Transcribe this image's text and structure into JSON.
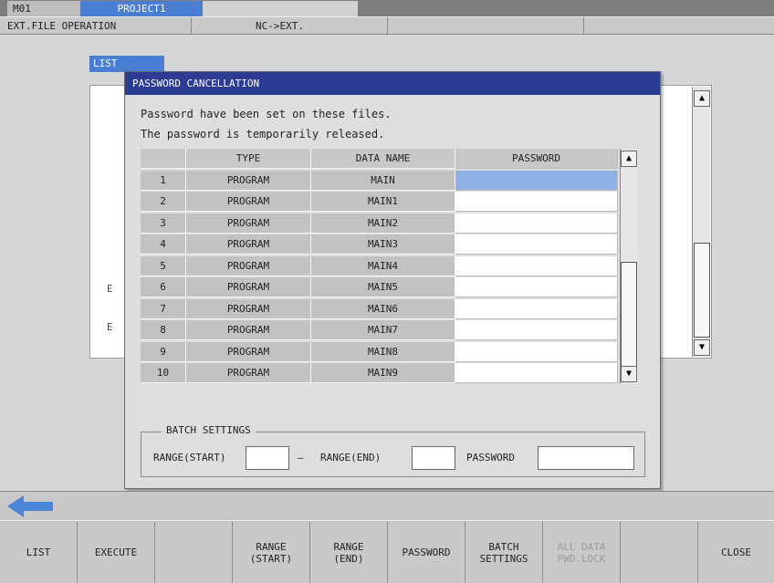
{
  "header": {
    "machine_tab": "M01",
    "project_tab": "PROJECT1",
    "sub_left": "EXT.FILE OPERATION",
    "sub_mid": "NC->EXT."
  },
  "background": {
    "list_tab": "LIST",
    "ghost_chars": [
      "E",
      "E"
    ]
  },
  "dialog": {
    "title": "PASSWORD CANCELLATION",
    "message_1": "Password have been set on these files.",
    "message_2": "The password is temporarily released.",
    "columns": [
      "",
      "TYPE",
      "DATA NAME",
      "PASSWORD"
    ],
    "rows": [
      {
        "no": "1",
        "type": "PROGRAM",
        "name": "MAIN",
        "password": ""
      },
      {
        "no": "2",
        "type": "PROGRAM",
        "name": "MAIN1",
        "password": ""
      },
      {
        "no": "3",
        "type": "PROGRAM",
        "name": "MAIN2",
        "password": ""
      },
      {
        "no": "4",
        "type": "PROGRAM",
        "name": "MAIN3",
        "password": ""
      },
      {
        "no": "5",
        "type": "PROGRAM",
        "name": "MAIN4",
        "password": ""
      },
      {
        "no": "6",
        "type": "PROGRAM",
        "name": "MAIN5",
        "password": ""
      },
      {
        "no": "7",
        "type": "PROGRAM",
        "name": "MAIN6",
        "password": ""
      },
      {
        "no": "8",
        "type": "PROGRAM",
        "name": "MAIN7",
        "password": ""
      },
      {
        "no": "9",
        "type": "PROGRAM",
        "name": "MAIN8",
        "password": ""
      },
      {
        "no": "10",
        "type": "PROGRAM",
        "name": "MAIN9",
        "password": ""
      }
    ],
    "selected_row": 1,
    "batch": {
      "legend": "BATCH SETTINGS",
      "range_start_label": "RANGE(START)",
      "dash": "–",
      "range_end_label": "RANGE(END)",
      "password_label": "PASSWORD",
      "range_start_value": "",
      "range_end_value": "",
      "password_value": ""
    }
  },
  "fkeys": [
    {
      "label": "LIST",
      "enabled": true
    },
    {
      "label": "EXECUTE",
      "enabled": true
    },
    {
      "label": "",
      "enabled": true
    },
    {
      "label": "RANGE\n(START)",
      "enabled": true
    },
    {
      "label": "RANGE\n(END)",
      "enabled": true
    },
    {
      "label": "PASSWORD",
      "enabled": true
    },
    {
      "label": "BATCH\nSETTINGS",
      "enabled": true
    },
    {
      "label": "ALL DATA\nPWD.LOCK",
      "enabled": false
    },
    {
      "label": "",
      "enabled": true
    },
    {
      "label": "CLOSE",
      "enabled": true
    }
  ],
  "icons": {
    "back": "left-arrow-icon",
    "scroll_up": "scroll-up-icon",
    "scroll_down": "scroll-down-icon"
  },
  "colors": {
    "accent": "#4a7ed2",
    "title_bar": "#2c3c94",
    "selection": "#8fb2e6",
    "back_arrow": "#4a86d8"
  }
}
